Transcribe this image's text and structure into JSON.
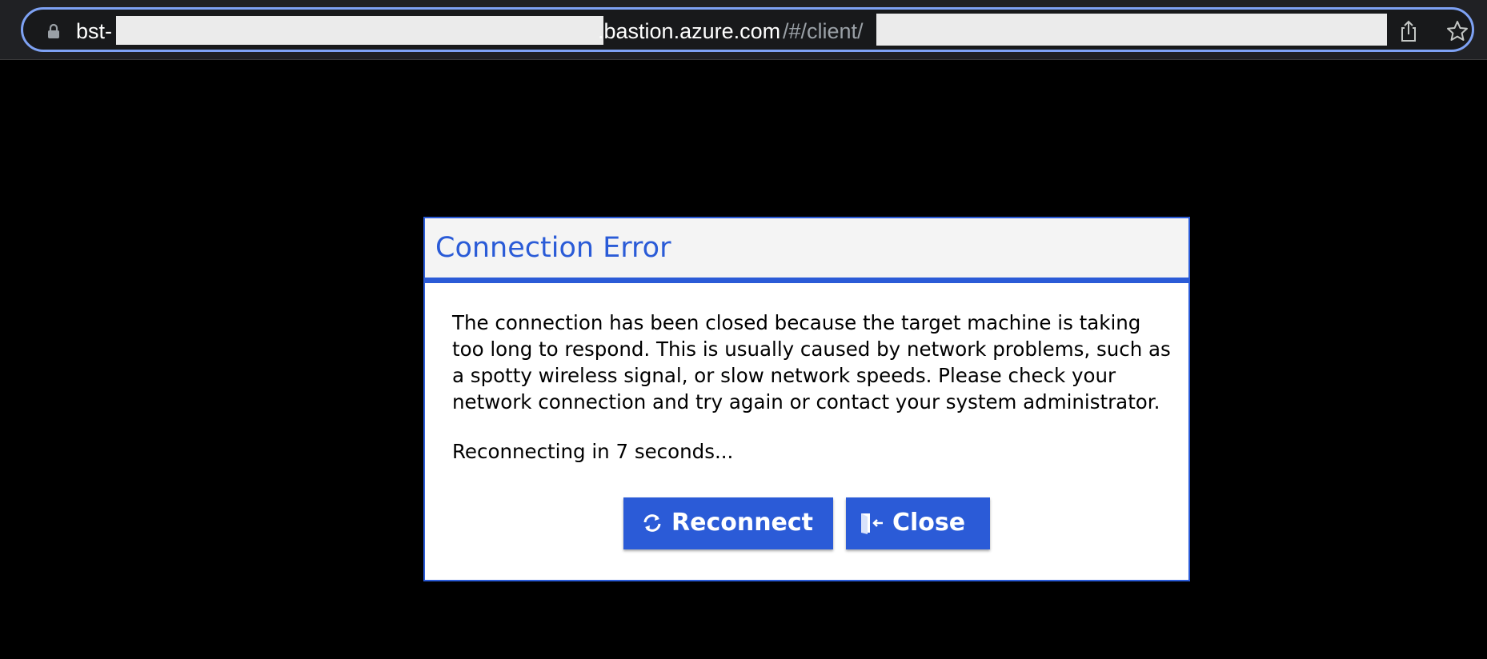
{
  "browser": {
    "url": {
      "prefix": "bst-",
      "host_suffix": ".bastion.azure.com",
      "path": "/#/client/"
    },
    "icons": {
      "lock": "lock-icon",
      "share": "share-icon",
      "bookmark": "star-icon"
    }
  },
  "dialog": {
    "title": "Connection Error",
    "message": "The connection has been closed because the target machine is taking too long to respond. This is usually caused by network problems, such as a spotty wireless signal, or slow network speeds. Please check your network connection and try again or contact your system administrator.",
    "countdown": "Reconnecting in 7 seconds...",
    "buttons": {
      "reconnect_label": "Reconnect",
      "reconnect_icon": "refresh-icon",
      "close_label": "Close",
      "close_icon": "exit-door-icon"
    }
  },
  "colors": {
    "accent": "#2b5bd7",
    "background": "#000000",
    "omnibox_border": "#7ea2f4"
  }
}
